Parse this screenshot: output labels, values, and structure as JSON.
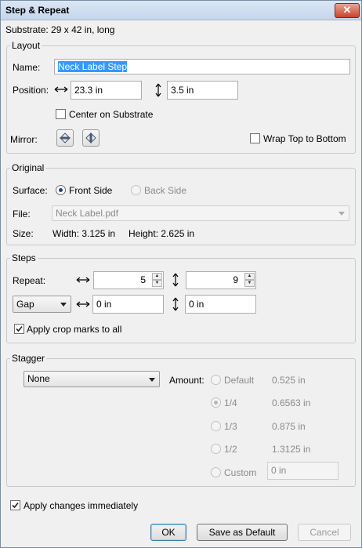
{
  "window": {
    "title": "Step & Repeat",
    "close_glyph": "✕"
  },
  "substrate": {
    "label": "Substrate:",
    "value": "29 x 42 in, long"
  },
  "layout": {
    "legend": "Layout",
    "name_label": "Name:",
    "name_value": "Neck Label Step",
    "position_label": "Position:",
    "pos_x": "23.3 in",
    "pos_y": "3.5 in",
    "center_label": "Center on Substrate",
    "center_checked": false,
    "mirror_label": "Mirror:",
    "wrap_label": "Wrap Top to Bottom",
    "wrap_checked": false
  },
  "original": {
    "legend": "Original",
    "surface_label": "Surface:",
    "front_label": "Front Side",
    "back_label": "Back Side",
    "file_label": "File:",
    "file_value": "Neck Label.pdf",
    "size_label": "Size:",
    "width_text": "Width:  3.125 in",
    "height_text": "Height:  2.625 in"
  },
  "steps": {
    "legend": "Steps",
    "repeat_label": "Repeat:",
    "repeat_x": "5",
    "repeat_y": "9",
    "gap_select": "Gap",
    "gap_x": "0 in",
    "gap_y": "0 in",
    "crop_label": "Apply crop marks to all",
    "crop_checked": true
  },
  "stagger": {
    "legend": "Stagger",
    "select": "None",
    "amount_label": "Amount:",
    "options": [
      {
        "label": "Default",
        "value": "0.525 in",
        "selected": false
      },
      {
        "label": "1/4",
        "value": "0.6563 in",
        "selected": true
      },
      {
        "label": "1/3",
        "value": "0.875 in",
        "selected": false
      },
      {
        "label": "1/2",
        "value": "1.3125 in",
        "selected": false
      }
    ],
    "custom_label": "Custom",
    "custom_value": "0 in"
  },
  "apply_label": "Apply changes immediately",
  "apply_checked": true,
  "buttons": {
    "ok": "OK",
    "save_default": "Save as Default",
    "cancel": "Cancel"
  },
  "icons": {
    "close": "close-icon",
    "horizontal_arrow": "horizontal-arrow-icon",
    "vertical_arrow": "vertical-arrow-icon",
    "mirror_vertical": "mirror-vertical-icon",
    "mirror_horizontal": "mirror-horizontal-icon",
    "checkmark": "checkmark-icon",
    "dropdown_arrow": "chevron-down-icon"
  }
}
